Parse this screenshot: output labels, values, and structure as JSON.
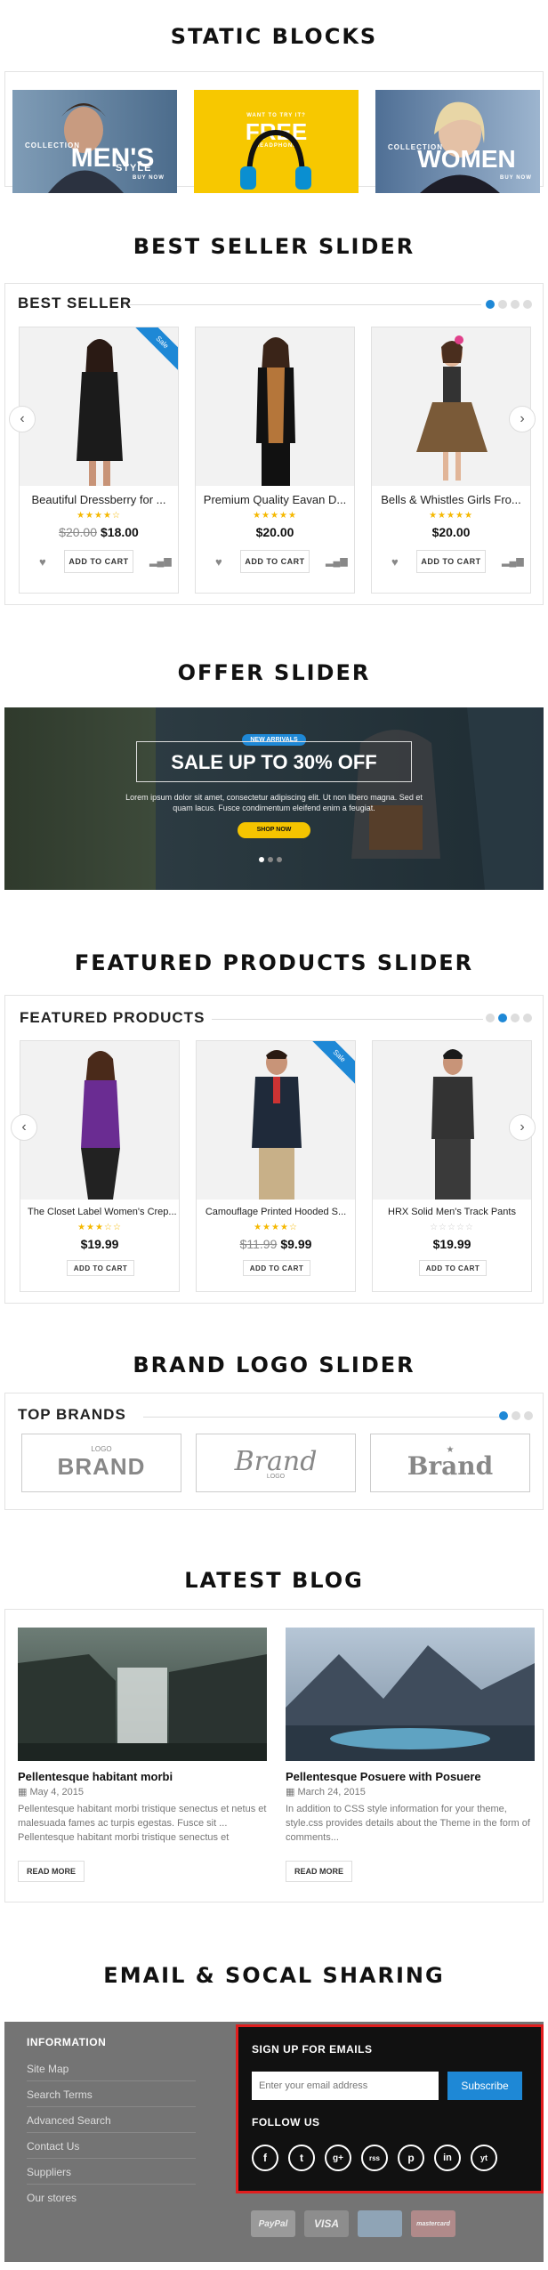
{
  "sections": {
    "static_blocks": "STATIC BLOCKS",
    "best_seller_slider": "BEST SELLER SLIDER",
    "offer_slider": "OFFER SLIDER",
    "featured_slider": "FEATURED PRODUCTS SLIDER",
    "brand_slider": "BRAND LOGO SLIDER",
    "latest_blog": "LATEST BLOG",
    "email_social": "EMAIL & SOCAL SHARING"
  },
  "static_blocks": [
    {
      "small": "COLLECTION",
      "big": "MEN'S",
      "sub": "STYLE",
      "cta": "BUY NOW"
    },
    {
      "small": "WANT TO TRY IT?",
      "big": "FREE",
      "sub": "HEADPHONE",
      "cta": ""
    },
    {
      "small": "COLLECTION",
      "big": "WOMEN",
      "sub": "",
      "cta": "BUY NOW"
    }
  ],
  "best_seller": {
    "heading": "BEST SELLER",
    "prev": "‹",
    "next": "›",
    "products": [
      {
        "name": "Beautiful Dressberry for ...",
        "stars": "★★★★☆",
        "old_price": "$20.00",
        "price": "$18.00",
        "cart": "ADD TO CART",
        "sale": "Sale"
      },
      {
        "name": "Premium Quality Eavan D...",
        "stars": "★★★★★",
        "old_price": "",
        "price": "$20.00",
        "cart": "ADD TO CART",
        "sale": ""
      },
      {
        "name": "Bells & Whistles Girls Fro...",
        "stars": "★★★★★",
        "old_price": "",
        "price": "$20.00",
        "cart": "ADD TO CART",
        "sale": ""
      }
    ]
  },
  "offer": {
    "badge": "NEW ARRIVALS",
    "headline": "SALE UP TO 30% OFF",
    "text1": "Lorem ipsum dolor sit amet, consectetur adipiscing elit. Ut non libero magna. Sed et",
    "text2": "quam lacus. Fusce condimentum eleifend enim a feugiat.",
    "cta": "SHOP NOW"
  },
  "featured": {
    "heading": "FEATURED PRODUCTS",
    "prev": "‹",
    "next": "›",
    "products": [
      {
        "name": "The Closet Label Women's Crep...",
        "stars": "★★★☆☆",
        "old_price": "",
        "price": "$19.99",
        "cart": "ADD TO CART",
        "sale": ""
      },
      {
        "name": "Camouflage Printed Hooded S...",
        "stars": "★★★★☆",
        "old_price": "$11.99",
        "price": "$9.99",
        "cart": "ADD TO CART",
        "sale": "Sale"
      },
      {
        "name": "HRX Solid Men's Track Pants",
        "stars": "☆☆☆☆☆",
        "old_price": "",
        "price": "$19.99",
        "cart": "ADD TO CART",
        "sale": ""
      }
    ]
  },
  "brands": {
    "heading": "TOP BRANDS",
    "logos": [
      {
        "top": "LOGO",
        "word": "BRAND"
      },
      {
        "top": "",
        "word": "Brand",
        "bottom": "LOGO"
      },
      {
        "top": "★",
        "word": "Brand"
      }
    ]
  },
  "blog": {
    "posts": [
      {
        "title": "Pellentesque habitant morbi",
        "date": "May 4, 2015",
        "text": "Pellentesque habitant morbi tristique senectus et netus et malesuada fames ac turpis egestas. Fusce sit ... Pellentesque habitant morbi tristique senectus et",
        "more": "READ MORE"
      },
      {
        "title": "Pellentesque Posuere with Posuere",
        "date": "March 24, 2015",
        "text": "In addition to CSS style information for your theme, style.css provides details about the Theme in the form of comments...",
        "more": "READ MORE"
      }
    ]
  },
  "footer": {
    "info_heading": "INFORMATION",
    "links": [
      "Site Map",
      "Search Terms",
      "Advanced Search",
      "Contact Us",
      "Suppliers",
      "Our stores"
    ],
    "signup_heading": "SIGN UP FOR EMAILS",
    "email_placeholder": "Enter your email address",
    "subscribe": "Subscribe",
    "follow_heading": "FOLLOW US",
    "social": [
      "f",
      "t",
      "g+",
      "rss",
      "p",
      "in",
      "yt"
    ],
    "payments": [
      "PayPal",
      "VISA",
      "",
      "mastercard"
    ]
  },
  "colors": {
    "accent": "#1e88d6",
    "star": "#f5b800",
    "offer_cta": "#f5c400",
    "highlight": "#e01e1e"
  }
}
